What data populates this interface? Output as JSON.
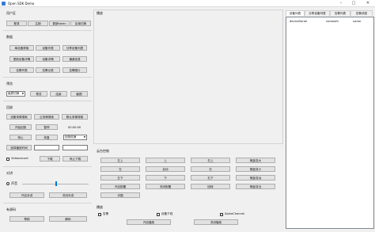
{
  "window": {
    "title": "Open SDK Demo",
    "minimize": "–",
    "maximize": "□",
    "close": "✕"
  },
  "user": {
    "title": "用户区",
    "login": "登录",
    "logout": "注销",
    "update_token": "更新token",
    "switch_region": "区域切换"
  },
  "data": {
    "title": "数据",
    "single_device": "单设备获取",
    "device_list": "设备列表",
    "share_device_list": "分享设备列表",
    "device_detail": "更新设备详情",
    "device_info": "设备详情",
    "channel_info": "通道信息",
    "alarm_list": "告警列表",
    "alarm_record": "告警记录",
    "alarm_image": "告警图片"
  },
  "preview": {
    "title": "预览",
    "quality_select": "画质切换",
    "preview": "预览",
    "stop": "结束",
    "capture": "截图"
  },
  "playback": {
    "title": "回放",
    "device_search": "设备录像搜索",
    "cloud_search": "云录像搜索",
    "default_search": "默认录像搜索",
    "start_playback": "开始回放",
    "pause": "暂停",
    "time": "00:00:00",
    "stop": "停止",
    "resume": "恢复",
    "speed": "回放倍速",
    "select_time": "选择播放时间",
    "videorecord": "Videorecord",
    "download": "下载",
    "stop_download": "停止下载"
  },
  "talk": {
    "title": "对讲",
    "volume": "声音",
    "start_talk": "开启对讲",
    "stop_talk": "关闭对讲"
  },
  "other": {
    "title": "有源码",
    "help": "帮助",
    "about": "解码"
  },
  "display": {
    "title": "播放"
  },
  "ptz": {
    "title": "云台控制",
    "buttons": [
      [
        "左上",
        "上",
        "右上",
        "焦距变大"
      ],
      [
        "左",
        "自动",
        "右",
        "焦距变小"
      ],
      [
        "左下",
        "下",
        "右下",
        "焦距变远"
      ],
      [
        "开启配置",
        "关闭配置",
        "回转",
        "焦距变近"
      ],
      [
        "光圈",
        "",
        "",
        ""
      ]
    ]
  },
  "options": {
    "title": "播放",
    "alarm": "告警",
    "device_offline": "设备下线",
    "alpha_channel": "AlphaChannel",
    "start_play": "开启播放",
    "stop_play": "关闭播放"
  },
  "right_panel": {
    "tabs": [
      "设备列表",
      "分享设备列表",
      "告警列表",
      "告警消息"
    ],
    "columns": [
      "deviceSerial",
      "nameofn",
      "name"
    ]
  }
}
